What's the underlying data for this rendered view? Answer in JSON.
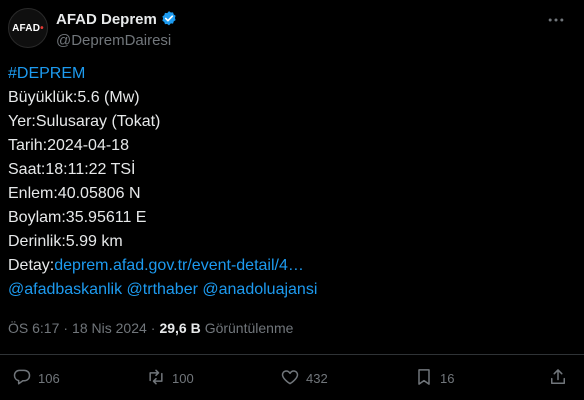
{
  "account": {
    "avatar_text": "AFAD",
    "display_name": "AFAD Deprem",
    "handle": "@DepremDairesi"
  },
  "tweet": {
    "hashtag": "#DEPREM",
    "magnitude": "Büyüklük:5.6 (Mw)",
    "location": "Yer:Sulusaray (Tokat)",
    "date": "Tarih:2024-04-18",
    "time": "Saat:18:11:22 TSİ",
    "latitude": "Enlem:40.05806 N",
    "longitude": "Boylam:35.95611 E",
    "depth": "Derinlik:5.99 km",
    "detail_label": "Detay:",
    "detail_link": "deprem.afad.gov.tr/event-detail/4…",
    "mentions": [
      "@afadbaskanlik",
      "@trthaber",
      "@anadoluajansi"
    ]
  },
  "meta": {
    "time": "ÖS 6:17",
    "separator": "·",
    "date": "18 Nis 2024",
    "views_count": "29,6 B",
    "views_label": "Görüntülenme"
  },
  "actions": {
    "replies": "106",
    "reposts": "100",
    "likes": "432",
    "bookmarks": "16"
  },
  "colors": {
    "background": "#000000",
    "text": "#e7e9ea",
    "muted": "#71767b",
    "link": "#1d9bf0",
    "verified": "#1d9bf0"
  }
}
